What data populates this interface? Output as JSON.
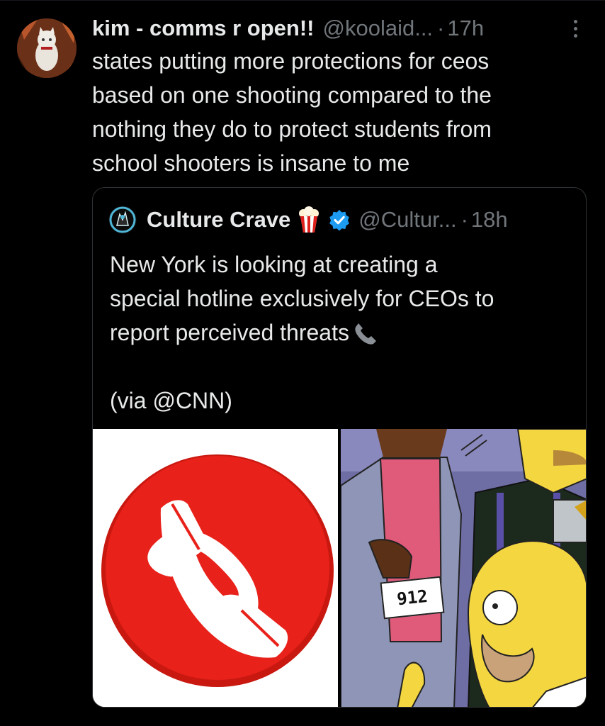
{
  "tweet": {
    "display_name": "kim - comms r open!!",
    "handle": "@koolaid...",
    "separator": "·",
    "time": "17h",
    "text": "states putting more protections for ceos\nbased on one shooting compared to the\nnothing they do to protect students from\nschool shooters is insane to me"
  },
  "quoted": {
    "display_name": "Culture Crave",
    "handle": "@Cultur...",
    "separator": "·",
    "time": "18h",
    "text_line1": "New York is looking at creating a",
    "text_line2": "special hotline exclusively for CEOs to",
    "text_line3": "report perceived threats",
    "via": "(via @CNN)",
    "media": {
      "right_image_badge": "912"
    }
  },
  "icons": {
    "more": "more-vertical-icon",
    "verified": "verified-badge-icon",
    "popcorn": "popcorn-emoji",
    "phone": "telephone-receiver-emoji"
  },
  "colors": {
    "background": "#000000",
    "text": "#e7e9ea",
    "secondary_text": "#71767b",
    "verified": "#1d9bf0",
    "call_button_red": "#e8211a"
  }
}
